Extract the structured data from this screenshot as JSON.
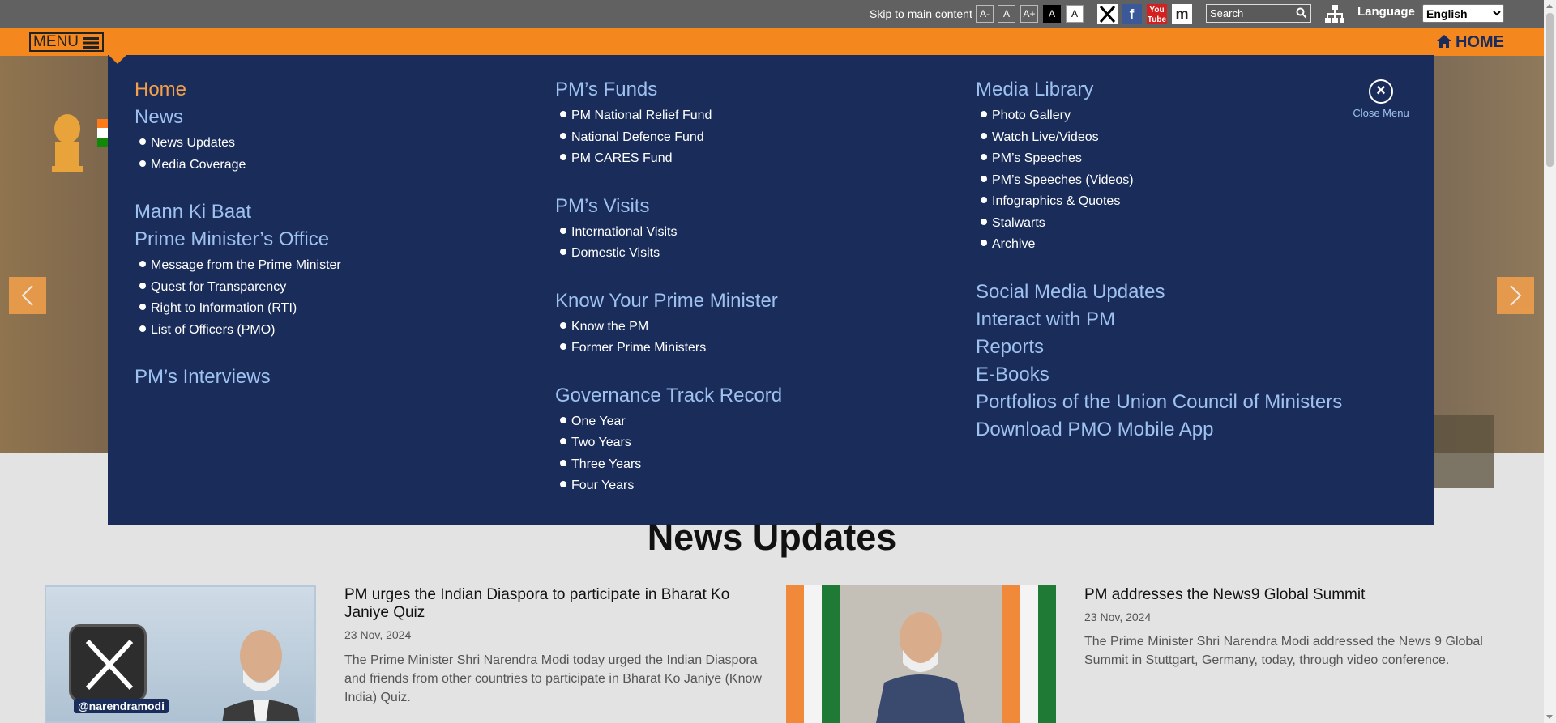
{
  "topbar": {
    "skip_link": "Skip to main content",
    "font_buttons": [
      "A-",
      "A",
      "A+",
      "A",
      "A"
    ],
    "search_placeholder": "Search",
    "language_label": "Language",
    "language_selected": "English"
  },
  "navbar": {
    "menu_label": "MENU",
    "home_label": "HOME"
  },
  "megamenu": {
    "columns": [
      [
        {
          "heading": "Home",
          "items": []
        },
        {
          "heading": "News",
          "items": [
            "News Updates",
            "Media Coverage"
          ]
        },
        {
          "heading": "Mann Ki Baat",
          "items": []
        },
        {
          "heading": "Prime Minister’s Office",
          "items": [
            "Message from the Prime Minister",
            "Quest for Transparency",
            "Right to Information (RTI)",
            "List of Officers (PMO)"
          ]
        },
        {
          "heading": "PM’s Interviews",
          "items": []
        }
      ],
      [
        {
          "heading": "PM’s Funds",
          "items": [
            "PM National Relief Fund",
            "National Defence Fund",
            "PM CARES Fund"
          ]
        },
        {
          "heading": "PM’s Visits",
          "items": [
            "International Visits",
            "Domestic Visits"
          ]
        },
        {
          "heading": "Know Your Prime Minister",
          "items": [
            "Know the PM",
            "Former Prime Ministers"
          ]
        },
        {
          "heading": "Governance Track Record",
          "items": [
            "One Year",
            "Two Years",
            "Three Years",
            "Four Years"
          ]
        }
      ],
      [
        {
          "heading": "Media Library",
          "items": [
            "Photo Gallery",
            "Watch Live/Videos",
            "PM’s Speeches",
            "PM’s Speeches (Videos)",
            "Infographics & Quotes",
            "Stalwarts",
            "Archive"
          ]
        },
        {
          "heading": "Social Media Updates",
          "items": []
        },
        {
          "heading": "Interact with PM",
          "items": []
        },
        {
          "heading": "Reports",
          "items": []
        },
        {
          "heading": "E-Books",
          "items": []
        },
        {
          "heading": "Portfolios of the Union Council of Ministers",
          "items": []
        },
        {
          "heading": "Download PMO Mobile App",
          "items": []
        }
      ]
    ],
    "close_label": "Close Menu"
  },
  "news": {
    "section_title": "News Updates",
    "articles": [
      {
        "title": "PM urges the Indian Diaspora to participate in Bharat Ko Janiye Quiz",
        "date": "23 Nov, 2024",
        "description": "The Prime Minister Shri Narendra Modi today urged the Indian Diaspora and friends from other countries to participate in Bharat Ko Janiye (Know India) Quiz.",
        "image_badge": "@narendramodi"
      },
      {
        "title": "PM addresses the News9 Global Summit",
        "date": "23 Nov, 2024",
        "description": "The Prime Minister Shri Narendra Modi addressed the News 9 Global Summit in Stuttgart, Germany, today, through video conference."
      }
    ]
  },
  "colors": {
    "orange": "#f5871f",
    "menu_bg": "#1a2d5a",
    "menu_heading": "#9ec1ef",
    "active_heading": "#f5a04a",
    "topbar": "#616161"
  }
}
